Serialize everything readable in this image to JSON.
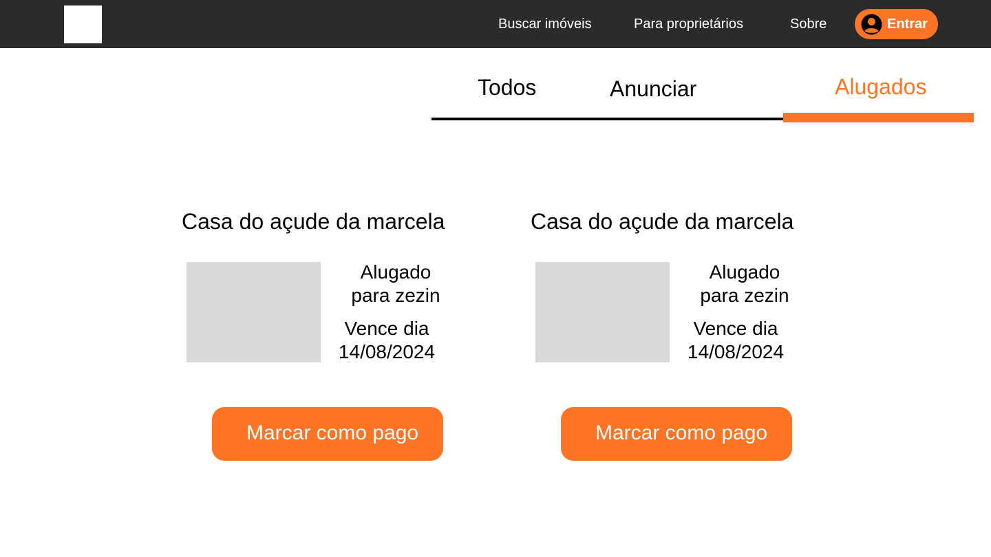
{
  "header": {
    "nav_links": [
      "Buscar imóveis",
      "Para proprietários",
      "Sobre"
    ],
    "login_label": "Entrar"
  },
  "tabs": [
    {
      "label": "Todos"
    },
    {
      "label": "Anunciar"
    },
    {
      "label": "Alugados",
      "active": true
    }
  ],
  "cards": [
    {
      "title": "Casa do açude da marcela",
      "status_line1": "Alugado",
      "status_line2": "para zezin",
      "due_line1": "Vence dia",
      "due_line2": "14/08/2024",
      "button_label": "Marcar como pago"
    },
    {
      "title": "Casa do açude da marcela",
      "status_line1": "Alugado",
      "status_line2": "para zezin",
      "due_line1": "Vence dia",
      "due_line2": "14/08/2024",
      "button_label": "Marcar como pago"
    }
  ],
  "colors": {
    "accent": "#ff7425",
    "navbar": "#2b2b2b",
    "placeholder": "#d9d9d9"
  }
}
